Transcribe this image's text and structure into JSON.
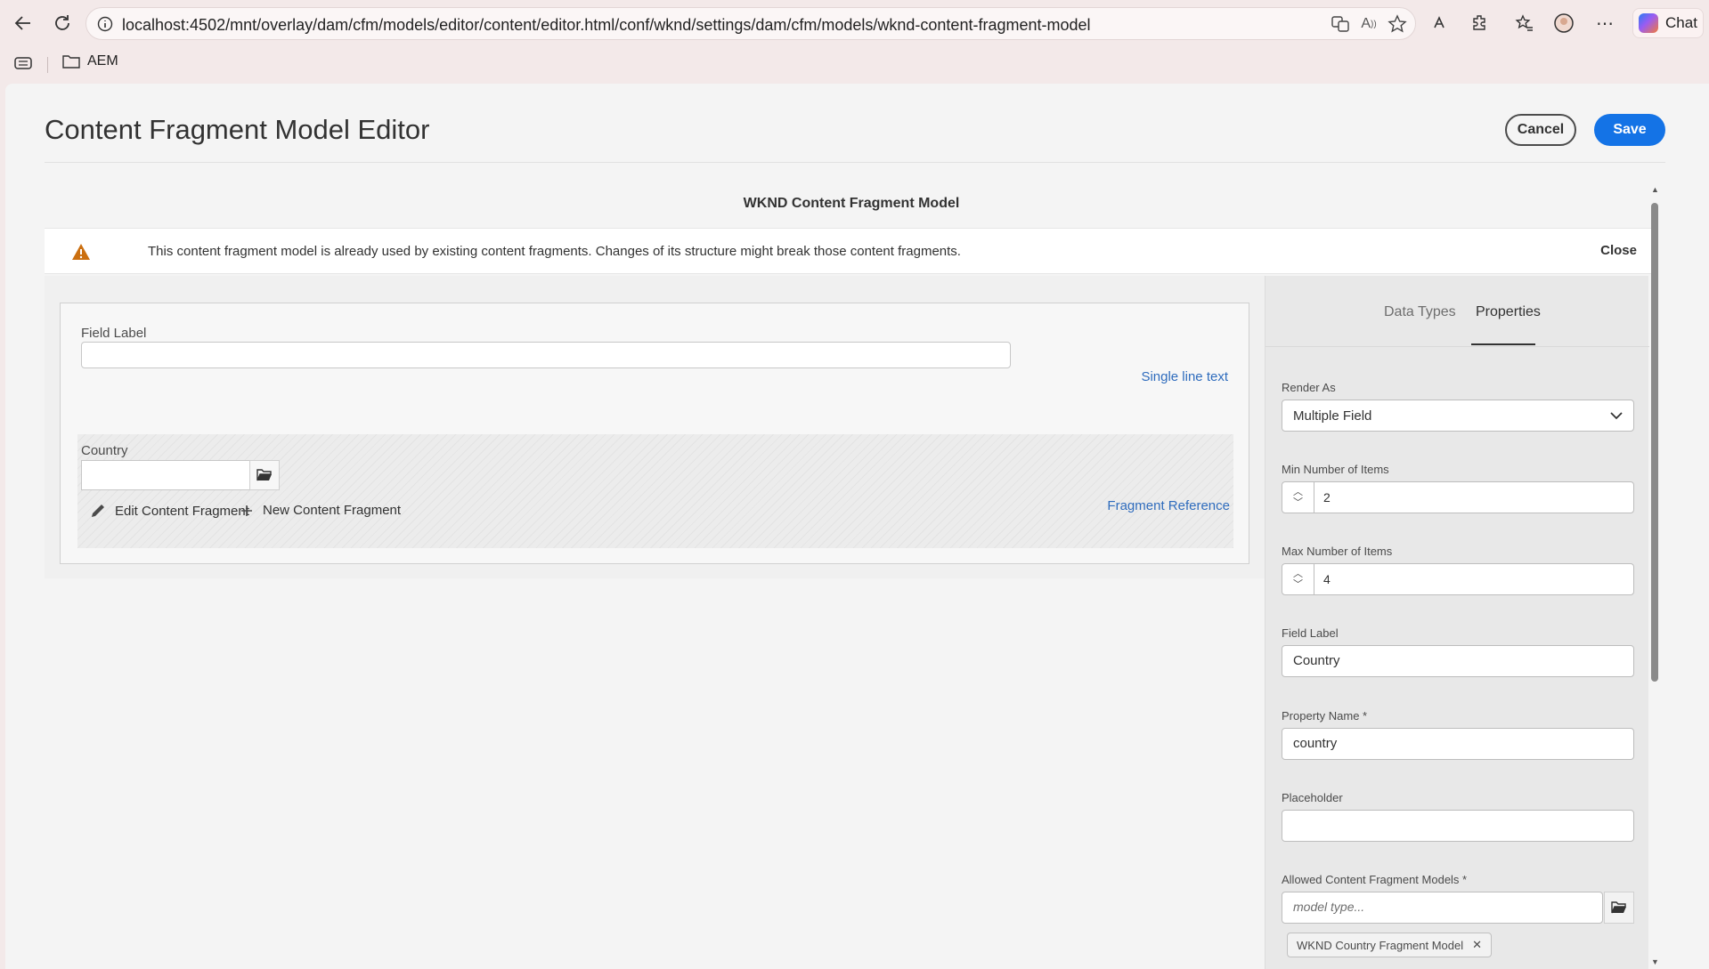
{
  "browser": {
    "url": "localhost:4502/mnt/overlay/dam/cfm/models/editor/content/editor.html/conf/wknd/settings/dam/cfm/models/wknd-content-fragment-model",
    "chat_label": "Chat",
    "bookmark_folder": "AEM"
  },
  "header": {
    "title": "Content Fragment Model Editor",
    "cancel_label": "Cancel",
    "save_label": "Save"
  },
  "model": {
    "name": "WKND Content Fragment Model"
  },
  "alert": {
    "message": "This content fragment model is already used by existing content fragments. Changes of its structure might break those content fragments.",
    "close_label": "Close"
  },
  "canvas": {
    "field1": {
      "label": "Field Label",
      "value": "",
      "type": "Single line text"
    },
    "field2": {
      "label": "Country",
      "value": "",
      "edit_action": "Edit Content Fragment",
      "new_action": "New Content Fragment",
      "type": "Fragment Reference"
    }
  },
  "side": {
    "tabs": [
      {
        "label": "Data Types",
        "active": false
      },
      {
        "label": "Properties",
        "active": true
      }
    ],
    "render_as": {
      "label": "Render As",
      "value": "Multiple Field"
    },
    "min_items": {
      "label": "Min Number of Items",
      "value": "2"
    },
    "max_items": {
      "label": "Max Number of Items",
      "value": "4"
    },
    "field_label": {
      "label": "Field Label",
      "value": "Country"
    },
    "property_name": {
      "label": "Property Name *",
      "value": "country"
    },
    "placeholder": {
      "label": "Placeholder",
      "value": ""
    },
    "allowed_models": {
      "label": "Allowed Content Fragment Models *",
      "placeholder": "model type...",
      "tags": [
        "WKND Country Fragment Model"
      ]
    }
  },
  "colors": {
    "accent": "#1473e6",
    "link": "#2f6cbd",
    "warning": "#cb6f10"
  }
}
